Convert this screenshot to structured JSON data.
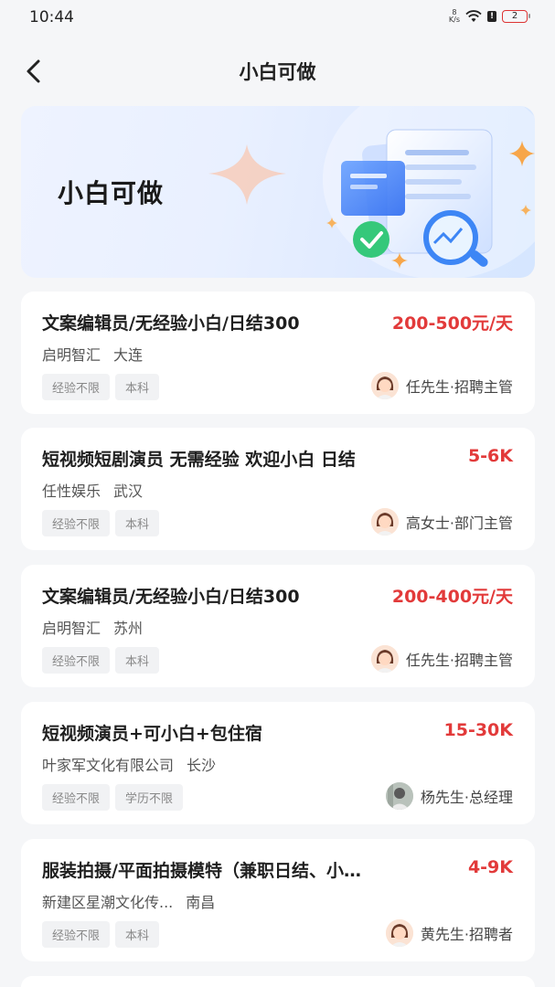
{
  "status": {
    "time": "10:44",
    "net_speed_top": "8",
    "net_speed_bottom": "K/s",
    "battery": "2"
  },
  "nav": {
    "title": "小白可做"
  },
  "banner": {
    "title": "小白可做"
  },
  "jobs": [
    {
      "title": "文案编辑员/无经验小白/日结300",
      "salary": "200-500元/天",
      "company": "启明智汇",
      "city": "大连",
      "tags": [
        "经验不限",
        "本科"
      ],
      "recruiter": "任先生·招聘主管",
      "avatar": "female-avatar"
    },
    {
      "title": "短视频短剧演员 无需经验 欢迎小白 日结",
      "salary": "5-6K",
      "company": "任性娱乐",
      "city": "武汉",
      "tags": [
        "经验不限",
        "本科"
      ],
      "recruiter": "高女士·部门主管",
      "avatar": "female-avatar"
    },
    {
      "title": "文案编辑员/无经验小白/日结300",
      "salary": "200-400元/天",
      "company": "启明智汇",
      "city": "苏州",
      "tags": [
        "经验不限",
        "本科"
      ],
      "recruiter": "任先生·招聘主管",
      "avatar": "female-avatar"
    },
    {
      "title": "短视频演员+可小白+包住宿",
      "salary": "15-30K",
      "company": "叶家军文化有限公司",
      "city": "长沙",
      "tags": [
        "经验不限",
        "学历不限"
      ],
      "recruiter": "杨先生·总经理",
      "avatar": "male-avatar"
    },
    {
      "title": "服装拍摄/平面拍摄模特（兼职日结、小…",
      "salary": "4-9K",
      "company": "新建区星潮文化传...",
      "city": "南昌",
      "tags": [
        "经验不限",
        "本科"
      ],
      "recruiter": "黄先生·招聘者",
      "avatar": "female-avatar"
    }
  ],
  "colors": {
    "accent_salary": "#e23a3a",
    "background": "#f5f6f8"
  }
}
